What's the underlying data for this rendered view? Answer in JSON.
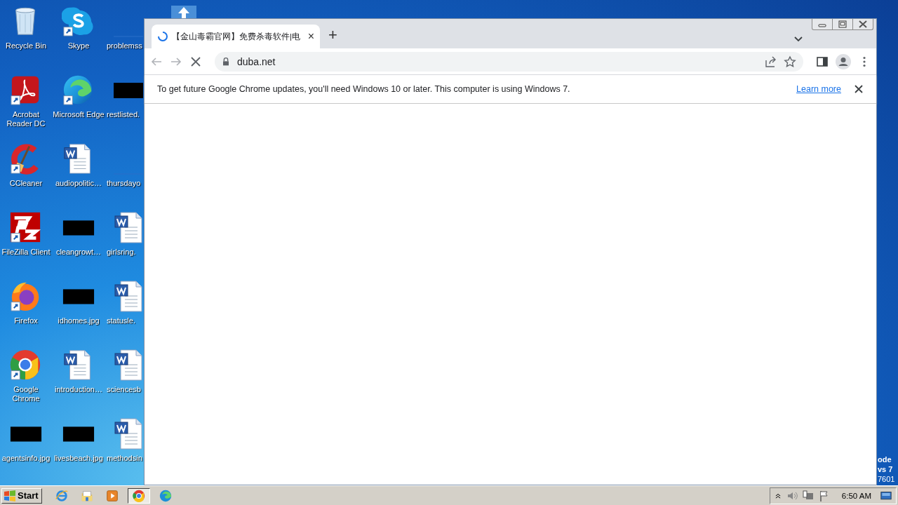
{
  "desktop": {
    "icons": [
      {
        "label": "Recycle Bin",
        "kind": "recycle",
        "shortcut": false
      },
      {
        "label": "Acrobat Reader DC",
        "kind": "acrobat",
        "shortcut": true
      },
      {
        "label": "CCleaner",
        "kind": "ccleaner",
        "shortcut": true
      },
      {
        "label": "FileZilla Client",
        "kind": "filezilla",
        "shortcut": true
      },
      {
        "label": "Firefox",
        "kind": "firefox",
        "shortcut": true
      },
      {
        "label": "Google Chrome",
        "kind": "chrome",
        "shortcut": true
      },
      {
        "label": "agentsinfo.jpg",
        "kind": "thumbnail",
        "shortcut": false
      },
      {
        "label": "Skype",
        "kind": "skype",
        "shortcut": true
      },
      {
        "label": "Microsoft Edge",
        "kind": "edge",
        "shortcut": true
      },
      {
        "label": "audiopolitic…",
        "kind": "word",
        "shortcut": false
      },
      {
        "label": "cleangrowt…",
        "kind": "thumbnail",
        "shortcut": false
      },
      {
        "label": "idhomes.jpg",
        "kind": "thumbnail",
        "shortcut": false
      },
      {
        "label": "introduction…",
        "kind": "word",
        "shortcut": false
      },
      {
        "label": "livesbeach.jpg",
        "kind": "thumbnail",
        "shortcut": false
      },
      {
        "label": "problemss",
        "kind": "blank",
        "shortcut": false
      },
      {
        "label": "restlisted.",
        "kind": "thumbnail",
        "shortcut": false
      },
      {
        "label": "thursdayo",
        "kind": "blank",
        "shortcut": false
      },
      {
        "label": "girlsring.",
        "kind": "word",
        "shortcut": false
      },
      {
        "label": "statusle.",
        "kind": "word",
        "shortcut": false
      },
      {
        "label": "sciencesb",
        "kind": "word",
        "shortcut": false
      },
      {
        "label": "methodsin",
        "kind": "word",
        "shortcut": false
      }
    ],
    "corner_text": [
      "ode",
      "vs 7",
      "7601"
    ]
  },
  "browser": {
    "tabs": [
      {
        "title": "【金山毒霸官网】免费杀毒软件|电",
        "selected": true,
        "loading": true,
        "close": "×"
      }
    ],
    "new_tab": "+",
    "toolbar": {
      "back_disabled": true,
      "forward_disabled": true,
      "url": "duba.net"
    },
    "infobar": {
      "message": "To get future Google Chrome updates, you'll need Windows 10 or later. This computer is using Windows 7.",
      "link": "Learn more"
    }
  },
  "taskbar": {
    "start": "Start",
    "apps": [
      {
        "kind": "ie",
        "selected": false
      },
      {
        "kind": "folder",
        "selected": false
      },
      {
        "kind": "media",
        "selected": false
      },
      {
        "kind": "chrome",
        "selected": true
      },
      {
        "kind": "edge",
        "selected": false
      }
    ],
    "clock": "6:50 AM"
  }
}
